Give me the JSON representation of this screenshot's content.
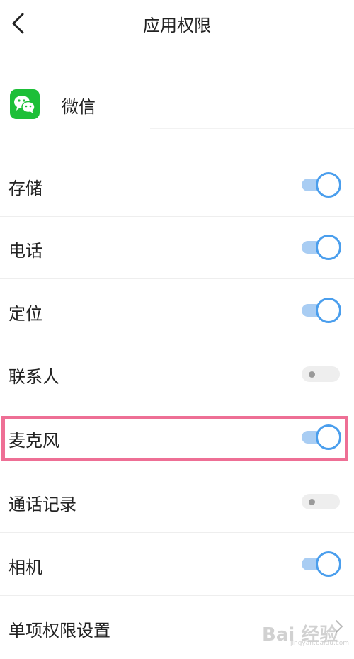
{
  "header": {
    "title": "应用权限",
    "back_icon": "chevron-left-icon"
  },
  "app": {
    "name": "微信",
    "icon": "wechat-icon",
    "icon_color": "#1dbf38"
  },
  "permissions": [
    {
      "label": "存储",
      "enabled": true
    },
    {
      "label": "电话",
      "enabled": true
    },
    {
      "label": "定位",
      "enabled": true
    },
    {
      "label": "联系人",
      "enabled": false
    },
    {
      "label": "麦克风",
      "enabled": true,
      "highlighted": true
    },
    {
      "label": "通话记录",
      "enabled": false
    },
    {
      "label": "相机",
      "enabled": true
    }
  ],
  "single_settings": {
    "label": "单项权限设置",
    "icon": "chevron-right-icon"
  },
  "watermark": {
    "text": "Bai 经验",
    "sub": "jingyan.baidu.com"
  },
  "colors": {
    "toggle_on": "#4a9eed",
    "toggle_track_on": "#a9cdf3",
    "toggle_off": "#eeeeee",
    "highlight_border": "#ee6f95"
  }
}
